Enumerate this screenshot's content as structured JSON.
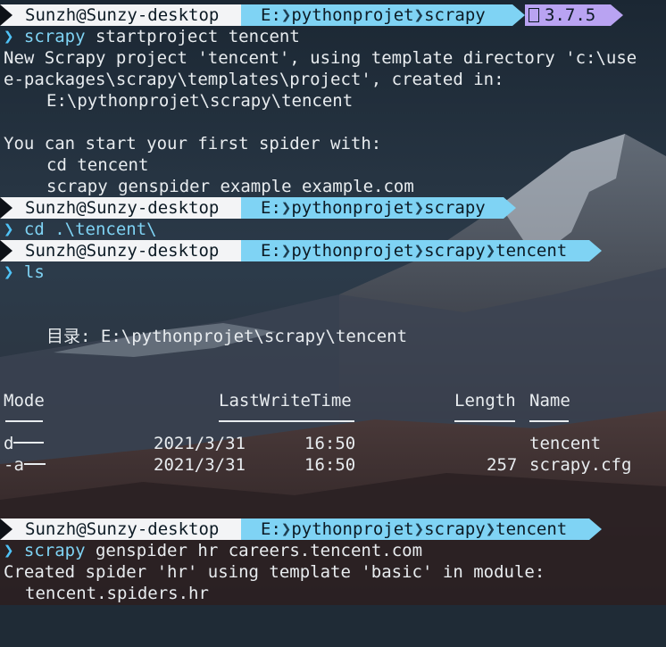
{
  "prompts": {
    "user": "Sunzh@Sunzy-desktop",
    "drive": "E:",
    "path_a": "pythonprojet",
    "path_b": "scrapy",
    "path_c": "tencent",
    "version": "3.7.5",
    "chevron": "❯"
  },
  "lines": {
    "cmd1_word": "scrapy",
    "cmd1_rest": " startproject tencent",
    "out1": "New Scrapy project 'tencent', using template directory 'c:\\use",
    "out2": "e-packages\\scrapy\\templates\\project', created in:",
    "out3": "E:\\pythonprojet\\scrapy\\tencent",
    "out4": "You can start your first spider with:",
    "out5": "cd tencent",
    "out6": "scrapy genspider example example.com",
    "cmd2": "cd .\\tencent\\",
    "cmd3": "ls",
    "dir_line": "目录: E:\\pythonprojet\\scrapy\\tencent",
    "cmd4_word": "scrapy",
    "cmd4_rest": " genspider hr careers.tencent.com",
    "out7": "Created spider 'hr' using template 'basic' in module:",
    "out8": "tencent.spiders.hr"
  },
  "listing": {
    "headers": {
      "mode": "Mode",
      "time": "LastWriteTime",
      "length": "Length",
      "name": "Name"
    },
    "rows": [
      {
        "mode": "d",
        "date": "2021/3/31",
        "time": "16:50",
        "length": "",
        "name": "tencent"
      },
      {
        "mode": "-a",
        "date": "2021/3/31",
        "time": "16:50",
        "length": "257",
        "name": "scrapy.cfg"
      }
    ]
  },
  "colors": {
    "user_bg": "#f3f4f6",
    "path_bg": "#7fd3f4",
    "version_bg": "#b9a3f2",
    "chevron": "#4fc3f7"
  }
}
